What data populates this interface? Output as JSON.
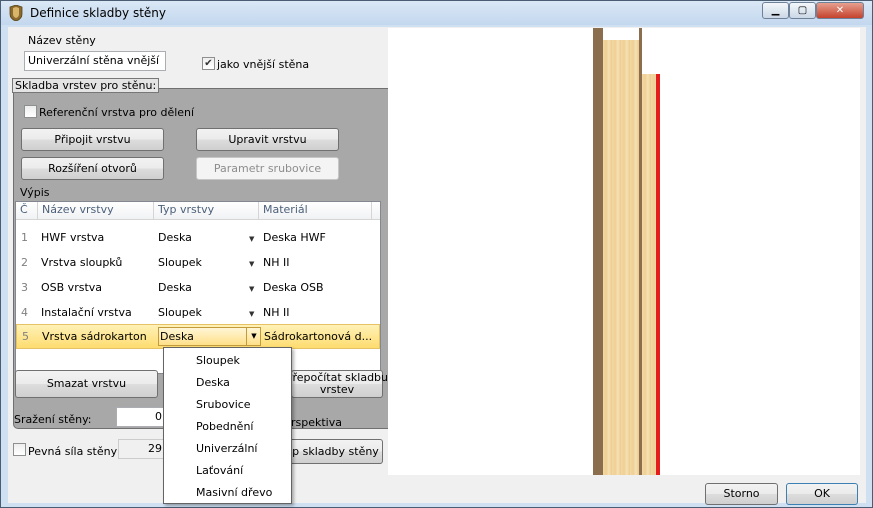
{
  "window": {
    "title": "Definice skladby stěny",
    "buttons": {
      "minimize": "▁",
      "maximize": "▢",
      "close": "✕"
    }
  },
  "wall_name": {
    "label": "Název stěny",
    "value": "Univerzální stěna vnější"
  },
  "exterior_check": {
    "label": "jako vnější stěna",
    "checked": true
  },
  "group": {
    "title": "Skladba vrstev pro stěnu:"
  },
  "reference_check": {
    "label": "Referenční vrstva pro dělení",
    "checked": false
  },
  "buttons": {
    "attach": "Připojit vrstvu",
    "edit": "Upravit vrstvu",
    "openings": "Rozšíření otvorů",
    "log_param": "Parametr srubovice",
    "delete": "Smazat vrstvu",
    "compute_line1": "Přepočítat skladbu",
    "compute_line2": "vrstev",
    "compute_prefix": "P",
    "save_line": "p skladby stěny",
    "cancel": "Storno",
    "ok": "OK"
  },
  "list": {
    "label": "Výpis",
    "columns": [
      "Č",
      "Název vrstvy",
      "Typ vrstvy",
      "Materiál"
    ],
    "rows": [
      {
        "num": "1",
        "name": "HWF vrstva",
        "type": "Deska",
        "material": "Deska HWF"
      },
      {
        "num": "2",
        "name": "Vrstva sloupků",
        "type": "Sloupek",
        "material": "NH II"
      },
      {
        "num": "3",
        "name": "OSB vrstva",
        "type": "Deska",
        "material": "Deska OSB"
      },
      {
        "num": "4",
        "name": "Instalační vrstva",
        "type": "Sloupek",
        "material": "NH II"
      },
      {
        "num": "5",
        "name": "Vrstva sádrokarton",
        "type": "Deska",
        "material": "Sádrokartonová d..."
      }
    ],
    "selected_row": 5
  },
  "dropdown": {
    "options": [
      "Sloupek",
      "Deska",
      "Srubovice",
      "Pobednění",
      "Univerzální",
      "Laťování",
      "Masivní dřevo"
    ]
  },
  "wall_offset": {
    "label": "Sražení stěny:",
    "value": "0"
  },
  "fixed_thickness": {
    "label": "Pevná síla stěny",
    "value": "29",
    "checked": false
  },
  "perspective": {
    "label": "rspektiva"
  },
  "colors": {
    "accent_red": "#e51c1c",
    "selection": "#fddc6f"
  }
}
